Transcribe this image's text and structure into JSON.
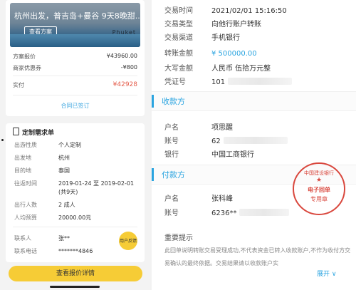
{
  "plan": {
    "banner_title": "杭州出发，普吉岛+曼谷 9天8晚甜...",
    "banner_button": "查看方案",
    "banner_text": "Phuket",
    "quote_label": "方案报价",
    "quote_value": "¥43960.00",
    "discount_label": "商家优惠券",
    "discount_value": "-¥800",
    "paid_label": "实付",
    "paid_value": "¥42928",
    "contract_status": "合同已签订"
  },
  "requirements": {
    "title": "定制需求单",
    "items": [
      {
        "k": "出游性质",
        "v": "个人定制"
      },
      {
        "k": "出发地",
        "v": "杭州"
      },
      {
        "k": "目的地",
        "v": "泰国"
      },
      {
        "k": "往返时间",
        "v": "2019-01-24 至 2019-02-01"
      },
      {
        "k": "",
        "v": "(共9天)"
      },
      {
        "k": "出行人数",
        "v": "2 成人"
      },
      {
        "k": "人均预算",
        "v": "20000.00元"
      },
      {
        "k": "联系人",
        "v": "张**"
      },
      {
        "k": "联系电话",
        "v": "*******4846"
      }
    ],
    "feedback": "用户反馈",
    "bottom_button": "查看报价详情"
  },
  "receipt": {
    "trade_time_label": "交易时间",
    "trade_time": "2021/02/01 15:16:50",
    "trade_type_label": "交易类型",
    "trade_type": "向他行账户转账",
    "channel_label": "交易渠道",
    "channel": "手机银行",
    "amount_label": "转账金额",
    "amount": "¥ 500000.00",
    "amount_cn_label": "大写金额",
    "amount_cn": "人民币 伍拾万元整",
    "voucher_label": "凭证号",
    "voucher": "101",
    "payee_title": "收款方",
    "payee_name_label": "户名",
    "payee_name": "项思醒",
    "payee_account_label": "账号",
    "payee_account": "62",
    "payee_bank_label": "银行",
    "payee_bank": "中国工商银行",
    "payer_title": "付款方",
    "payer_name_label": "户名",
    "payer_name": "张科峰",
    "payer_account_label": "账号",
    "payer_account": "6236**",
    "seal_top": "中国建设银行",
    "seal_mid": "电子回单",
    "seal_bot": "专用章",
    "notice_title": "重要提示",
    "notice_text": "此回单说明转账交易受理成功,不代表资金已转入收款账户,不作为收付方交易确认的最终依据。交易结果请以收款账户实",
    "expand": "展开"
  }
}
